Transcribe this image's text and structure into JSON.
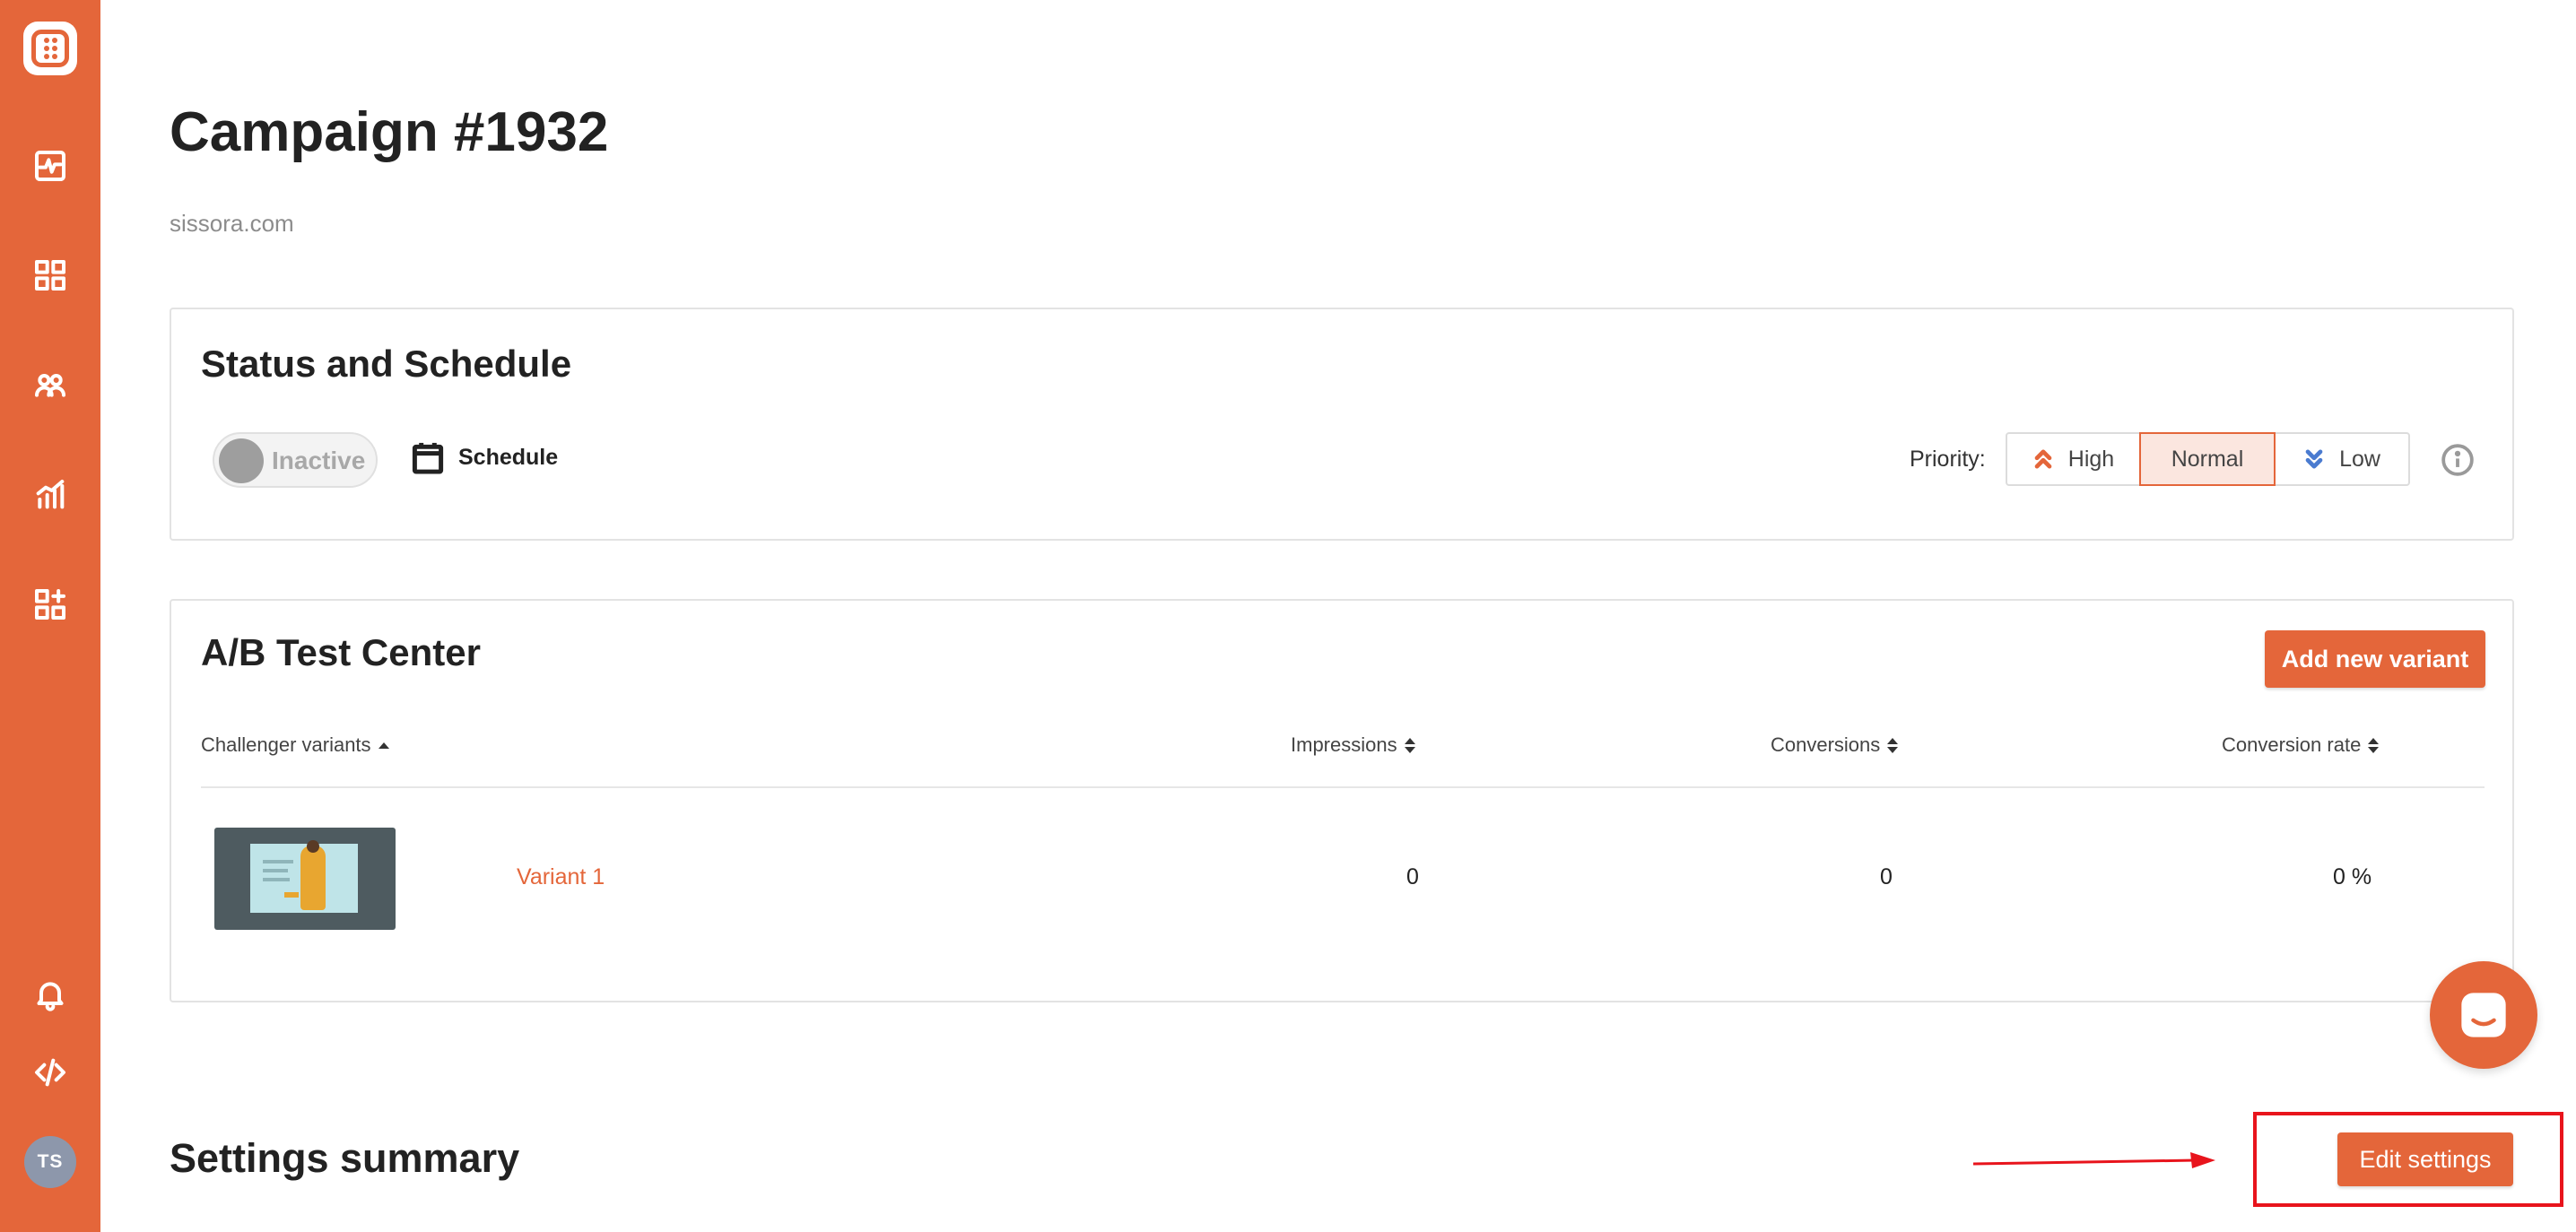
{
  "sidebar": {
    "logo_icon": "app-logo-icon",
    "items": [
      {
        "icon": "activity-icon"
      },
      {
        "icon": "dashboard-grid-icon"
      },
      {
        "icon": "users-icon"
      },
      {
        "icon": "analytics-chart-icon"
      },
      {
        "icon": "add-widget-icon"
      }
    ],
    "bottom_items": [
      {
        "icon": "bell-icon"
      },
      {
        "icon": "code-icon"
      }
    ],
    "avatar_initials": "TS"
  },
  "page": {
    "title": "Campaign #1932",
    "subtitle": "sissora.com"
  },
  "status_schedule": {
    "title": "Status and Schedule",
    "toggle_label": "Inactive",
    "schedule_label": "Schedule",
    "priority_label": "Priority:",
    "priority_options": [
      "High",
      "Normal",
      "Low"
    ],
    "selected_priority": "Normal"
  },
  "ab_test": {
    "title": "A/B Test Center",
    "add_button": "Add new variant",
    "columns": [
      "Challenger variants",
      "Impressions",
      "Conversions",
      "Conversion rate"
    ],
    "rows": [
      {
        "name": "Variant 1",
        "impressions": "0",
        "conversions": "0",
        "conversion_rate": "0 %"
      }
    ]
  },
  "settings_summary": {
    "title": "Settings summary",
    "edit_button": "Edit settings"
  },
  "colors": {
    "accent": "#e4663a",
    "annotation": "#e8141c"
  }
}
